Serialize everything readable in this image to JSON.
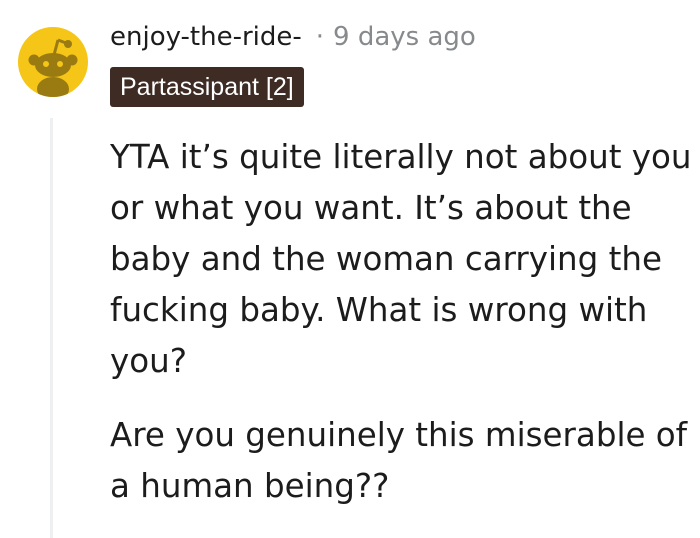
{
  "comment": {
    "username": "enjoy-the-ride-",
    "separator": "·",
    "timestamp": "9 days ago",
    "flair": "Partassipant [2]",
    "avatar_icon": "snoo-avatar-icon",
    "avatar_color": "#f5c518",
    "flair_color": "#3d2b24",
    "paragraphs": [
      "YTA it’s quite literally not about you\nor what you want. It’s about the\nbaby and the woman carrying the\nfucking baby. What is wrong with\nyou?",
      "Are you genuinely this miserable of\na human being??"
    ]
  }
}
